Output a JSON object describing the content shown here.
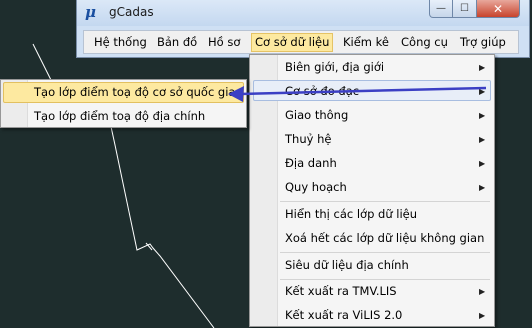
{
  "window": {
    "title": "gCadas",
    "app_icon": "gcadas-logo-icon",
    "controls": {
      "minimize": "minimize-icon",
      "maximize": "maximize-icon",
      "close": "close-icon"
    }
  },
  "menubar": {
    "items": [
      {
        "label": "Hệ thống"
      },
      {
        "label": "Bản đồ"
      },
      {
        "label": "Hồ sơ"
      },
      {
        "label": "Cơ sở dữ liệu",
        "active": true
      },
      {
        "label": "Kiểm kê"
      },
      {
        "label": "Công cụ"
      },
      {
        "label": "Trợ giúp"
      }
    ]
  },
  "dropdown": {
    "items": [
      {
        "label": "Biên giới, địa giới",
        "submenu": true
      },
      {
        "label": "Cơ sở đo đạc",
        "submenu": true,
        "highlighted": true
      },
      {
        "label": "Giao thông",
        "submenu": true
      },
      {
        "label": "Thuỷ hệ",
        "submenu": true
      },
      {
        "label": "Địa danh",
        "submenu": true
      },
      {
        "label": "Quy hoạch",
        "submenu": true
      },
      {
        "label": "Hiển thị các lớp dữ liệu"
      },
      {
        "label": "Xoá hết các lớp dữ liệu không gian"
      },
      {
        "label": "Siêu dữ liệu địa chính"
      },
      {
        "label": "Kết xuất ra TMV.LIS",
        "submenu": true
      },
      {
        "label": "Kết xuất ra ViLIS 2.0",
        "submenu": true
      }
    ]
  },
  "submenu": {
    "items": [
      {
        "label": "Tạo lớp điểm toạ độ cơ sở quốc gia",
        "selected": true
      },
      {
        "label": "Tạo lớp điểm toạ độ địa chính"
      }
    ]
  },
  "colors": {
    "background": "#1e2d2d",
    "annotation_arrow": "#3b3fc4",
    "selected_fill": "#fde9a0"
  }
}
